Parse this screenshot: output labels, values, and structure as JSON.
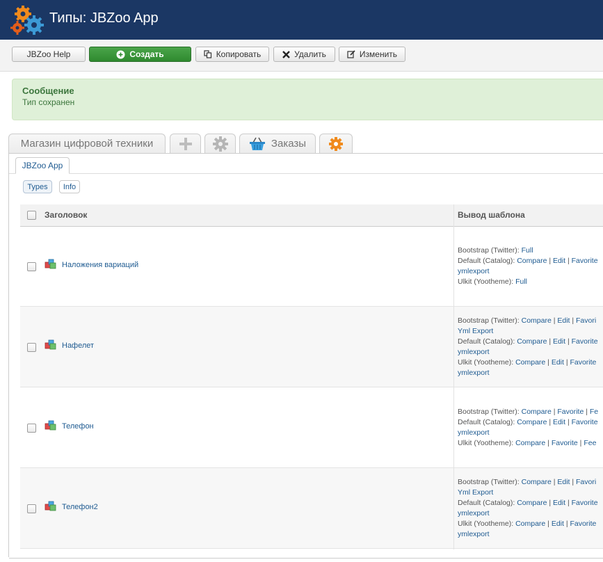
{
  "header": {
    "title": "Типы: JBZoo App",
    "logo_icon": "gears-logo-icon",
    "bg": "#1b3764"
  },
  "toolbar": {
    "help_label": "JBZoo Help",
    "create_label": "Создать",
    "copy_label": "Копировать",
    "delete_label": "Удалить",
    "edit_label": "Изменить"
  },
  "message": {
    "heading": "Сообщение",
    "text": "Тип сохранен"
  },
  "app_tabs": [
    {
      "label": "Магазин цифровой техники"
    },
    {
      "label": "",
      "icon": "plus-icon"
    },
    {
      "label": "",
      "icon": "gear-icon"
    },
    {
      "label": "Заказы",
      "icon": "basket-icon"
    },
    {
      "label": "",
      "icon": "jbzoo-gear-icon"
    }
  ],
  "sub_tab": "JBZoo App",
  "view_pills": [
    "Types",
    "Info"
  ],
  "table": {
    "headers": {
      "title": "Заголовок",
      "template": "Вывод шаблона"
    },
    "rows": [
      {
        "title": "Наложения вариаций",
        "lines": [
          [
            {
              "t": "Bootstrap (Twitter): ",
              "l": false
            },
            {
              "t": "Full",
              "l": true
            }
          ],
          [
            {
              "t": "Default (Catalog): ",
              "l": false
            },
            {
              "t": "Compare",
              "l": true
            },
            {
              "t": " | ",
              "l": false
            },
            {
              "t": "Edit",
              "l": true
            },
            {
              "t": " | ",
              "l": false
            },
            {
              "t": "Favorite",
              "l": true
            }
          ],
          [
            {
              "t": "ymlexport",
              "l": true
            }
          ],
          [
            {
              "t": "Ulkit (Yootheme): ",
              "l": false
            },
            {
              "t": "Full",
              "l": true
            }
          ]
        ]
      },
      {
        "title": "Нафелет",
        "lines": [
          [
            {
              "t": "Bootstrap (Twitter): ",
              "l": false
            },
            {
              "t": "Compare",
              "l": true
            },
            {
              "t": " | ",
              "l": false
            },
            {
              "t": "Edit",
              "l": true
            },
            {
              "t": " | ",
              "l": false
            },
            {
              "t": "Favori",
              "l": true
            }
          ],
          [
            {
              "t": "Yml Export",
              "l": true
            }
          ],
          [
            {
              "t": "Default (Catalog): ",
              "l": false
            },
            {
              "t": "Compare",
              "l": true
            },
            {
              "t": " | ",
              "l": false
            },
            {
              "t": "Edit",
              "l": true
            },
            {
              "t": " | ",
              "l": false
            },
            {
              "t": "Favorite",
              "l": true
            }
          ],
          [
            {
              "t": "ymlexport",
              "l": true
            }
          ],
          [
            {
              "t": "Ulkit (Yootheme): ",
              "l": false
            },
            {
              "t": "Compare",
              "l": true
            },
            {
              "t": " | ",
              "l": false
            },
            {
              "t": "Edit",
              "l": true
            },
            {
              "t": " | ",
              "l": false
            },
            {
              "t": "Favorite",
              "l": true
            }
          ],
          [
            {
              "t": "ymlexport",
              "l": true
            }
          ]
        ]
      },
      {
        "title": "Телефон",
        "lines": [
          [
            {
              "t": "Bootstrap (Twitter): ",
              "l": false
            },
            {
              "t": "Compare",
              "l": true
            },
            {
              "t": " | ",
              "l": false
            },
            {
              "t": "Favorite",
              "l": true
            },
            {
              "t": " | ",
              "l": false
            },
            {
              "t": "Fe",
              "l": true
            }
          ],
          [
            {
              "t": "Default (Catalog): ",
              "l": false
            },
            {
              "t": "Compare",
              "l": true
            },
            {
              "t": " | ",
              "l": false
            },
            {
              "t": "Edit",
              "l": true
            },
            {
              "t": " | ",
              "l": false
            },
            {
              "t": "Favorite",
              "l": true
            }
          ],
          [
            {
              "t": "ymlexport",
              "l": true
            }
          ],
          [
            {
              "t": "Ulkit (Yootheme): ",
              "l": false
            },
            {
              "t": "Compare",
              "l": true
            },
            {
              "t": " | ",
              "l": false
            },
            {
              "t": "Favorite",
              "l": true
            },
            {
              "t": " | ",
              "l": false
            },
            {
              "t": "Fee",
              "l": true
            }
          ]
        ]
      },
      {
        "title": "Телефон2",
        "lines": [
          [
            {
              "t": "Bootstrap (Twitter): ",
              "l": false
            },
            {
              "t": "Compare",
              "l": true
            },
            {
              "t": " | ",
              "l": false
            },
            {
              "t": "Edit",
              "l": true
            },
            {
              "t": " | ",
              "l": false
            },
            {
              "t": "Favori",
              "l": true
            }
          ],
          [
            {
              "t": "Yml Export",
              "l": true
            }
          ],
          [
            {
              "t": "Default (Catalog): ",
              "l": false
            },
            {
              "t": "Compare",
              "l": true
            },
            {
              "t": " | ",
              "l": false
            },
            {
              "t": "Edit",
              "l": true
            },
            {
              "t": " | ",
              "l": false
            },
            {
              "t": "Favorite",
              "l": true
            }
          ],
          [
            {
              "t": "ymlexport",
              "l": true
            }
          ],
          [
            {
              "t": "Ulkit (Yootheme): ",
              "l": false
            },
            {
              "t": "Compare",
              "l": true
            },
            {
              "t": " | ",
              "l": false
            },
            {
              "t": "Edit",
              "l": true
            },
            {
              "t": " | ",
              "l": false
            },
            {
              "t": "Favorite",
              "l": true
            }
          ],
          [
            {
              "t": "ymlexport",
              "l": true
            }
          ]
        ]
      }
    ]
  }
}
